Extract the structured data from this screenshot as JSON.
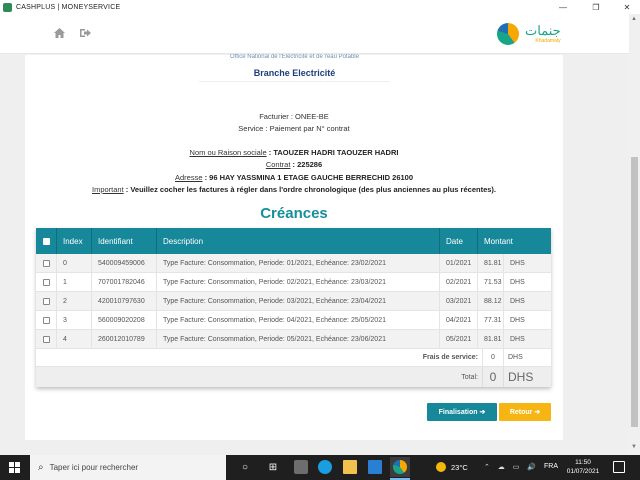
{
  "window": {
    "title": "CASHPLUS | MONEYSERVICE",
    "minimize": "—",
    "maximize": "❐",
    "close": "✕"
  },
  "header": {
    "home_icon": "home-icon",
    "logout_icon": "logout-icon",
    "brand_arabic": "جنمات",
    "brand_latin": "Khadamaty"
  },
  "biller": {
    "org_name": "Office National de l'Electricité et de l'eau Potable",
    "branch": "Branche Electricité",
    "facturier_label": "Facturier : ",
    "facturier_value": "ONEE-BE",
    "service_label": "Service : ",
    "service_value": "Paiement par N° contrat",
    "nom_label": "Nom ou Raison sociale",
    "nom_value": " : TAOUZER HADRI TAOUZER HADRI",
    "contrat_label": "Contrat",
    "contrat_value": " : 225286",
    "adresse_label": "Adresse",
    "adresse_value": " : 96 HAY YASSMINA 1 ETAGE GAUCHE BERRECHID 26100",
    "important_label": "Important",
    "important_value": " : Veuillez cocher les factures à régler dans l'ordre chronologique (des plus anciennes au plus récentes)."
  },
  "creances": {
    "title": "Créances",
    "headers": [
      "Index",
      "Identifiant",
      "Description",
      "Date",
      "Montant"
    ],
    "rows": [
      {
        "index": "0",
        "id": "540009459006",
        "desc": "Type Facture: Consommation, Periode: 01/2021, Echéance: 23/02/2021",
        "date": "01/2021",
        "amount": "81.81",
        "cur": "DHS"
      },
      {
        "index": "1",
        "id": "707001782046",
        "desc": "Type Facture: Consommation, Periode: 02/2021, Echéance: 23/03/2021",
        "date": "02/2021",
        "amount": "71.53",
        "cur": "DHS"
      },
      {
        "index": "2",
        "id": "420010797630",
        "desc": "Type Facture: Consommation, Periode: 03/2021, Echéance: 23/04/2021",
        "date": "03/2021",
        "amount": "88.12",
        "cur": "DHS"
      },
      {
        "index": "3",
        "id": "560009020208",
        "desc": "Type Facture: Consommation, Periode: 04/2021, Echéance: 25/05/2021",
        "date": "04/2021",
        "amount": "77.31",
        "cur": "DHS"
      },
      {
        "index": "4",
        "id": "260012010789",
        "desc": "Type Facture: Consommation, Periode: 05/2021, Echéance: 23/06/2021",
        "date": "05/2021",
        "amount": "81.81",
        "cur": "DHS"
      }
    ],
    "fees_label": "Frais de service:",
    "fees_value": "0",
    "fees_cur": "DHS",
    "total_label": "Total:",
    "total_value": "0",
    "total_cur": "DHS"
  },
  "buttons": {
    "finalisation": "Finalisation ➔",
    "retour": "Retour ➔"
  },
  "taskbar": {
    "search_placeholder": "Taper ici pour rechercher",
    "temperature": "23°C",
    "tray_icons": "⌃ ☁ ▭ 🔊",
    "language": "FRA",
    "time": "11:50",
    "date": "01/07/2021"
  },
  "colors": {
    "accent": "#16889a",
    "title_teal": "#168f9b",
    "retour_yellow": "#f7b514",
    "brand_green": "#17a589"
  }
}
